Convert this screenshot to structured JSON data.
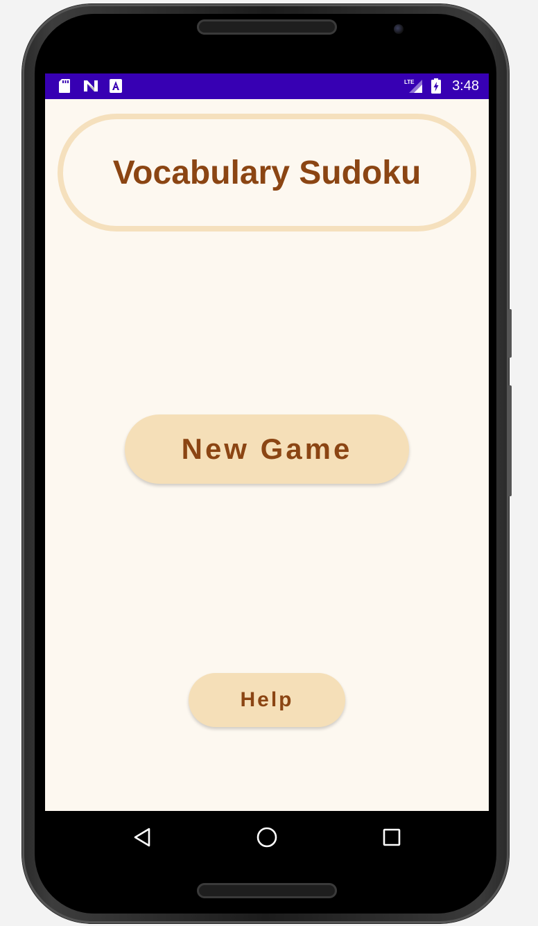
{
  "status_bar": {
    "time": "3:48",
    "background_color": "#3700b3",
    "left_icons": [
      "sd-card-icon",
      "n-logo-icon",
      "accessibility-a-icon"
    ],
    "right_icons": [
      "lte-signal-icon",
      "battery-charging-icon"
    ],
    "network_label": "LTE"
  },
  "app": {
    "title": "Vocabulary Sudoku",
    "new_game_label": "New Game",
    "help_label": "Help",
    "colors": {
      "background": "#fdf8f0",
      "accent": "#f5dfb8",
      "text": "#8b4513",
      "title_border": "#f5e0bd"
    }
  },
  "nav_bar": {
    "buttons": [
      "back-icon",
      "home-icon",
      "recents-icon"
    ]
  }
}
